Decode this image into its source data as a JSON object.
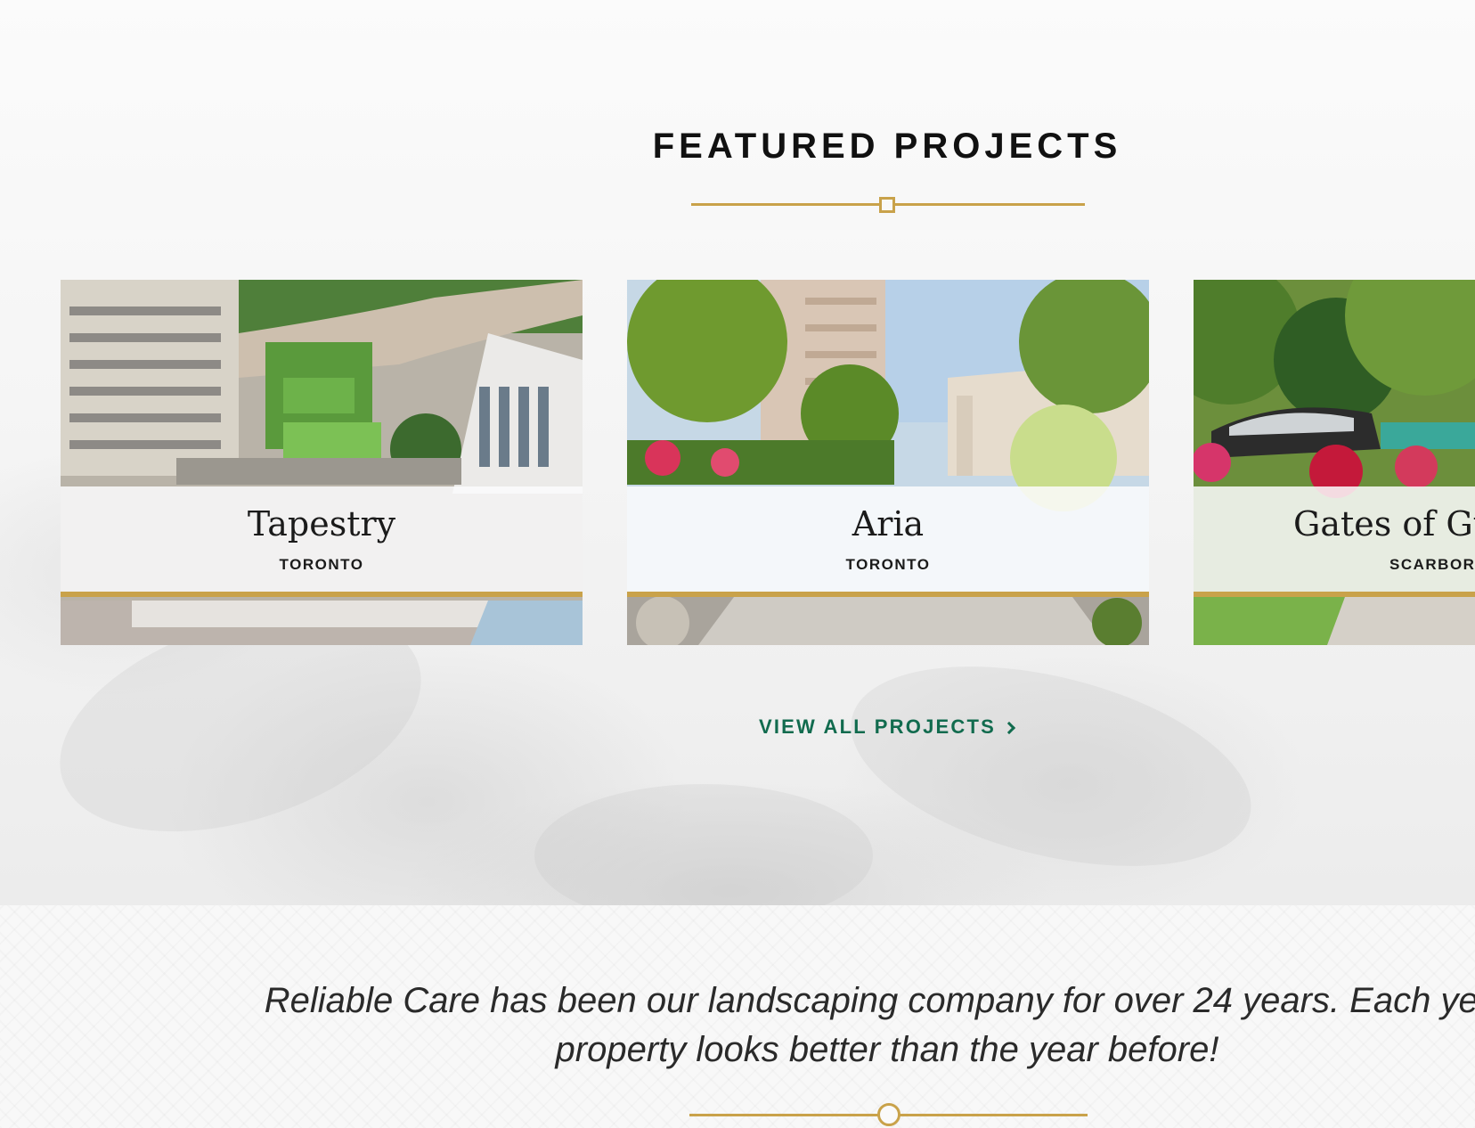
{
  "section": {
    "title": "FEATURED PROJECTS"
  },
  "projects": [
    {
      "name": "Tapestry",
      "city": "TORONTO"
    },
    {
      "name": "Aria",
      "city": "TORONTO"
    },
    {
      "name": "Gates of Gu",
      "city": "SCARBORO"
    }
  ],
  "view_all": {
    "label": "VIEW ALL PROJECTS",
    "icon": "chevron-right-icon"
  },
  "testimonial": {
    "line1": "Reliable Care has been our landscaping company for over 24 years. Each year",
    "line2": "property looks better than the year before!"
  },
  "colors": {
    "gold": "#c9a24a",
    "green_link": "#116b4e",
    "heading": "#111111"
  }
}
